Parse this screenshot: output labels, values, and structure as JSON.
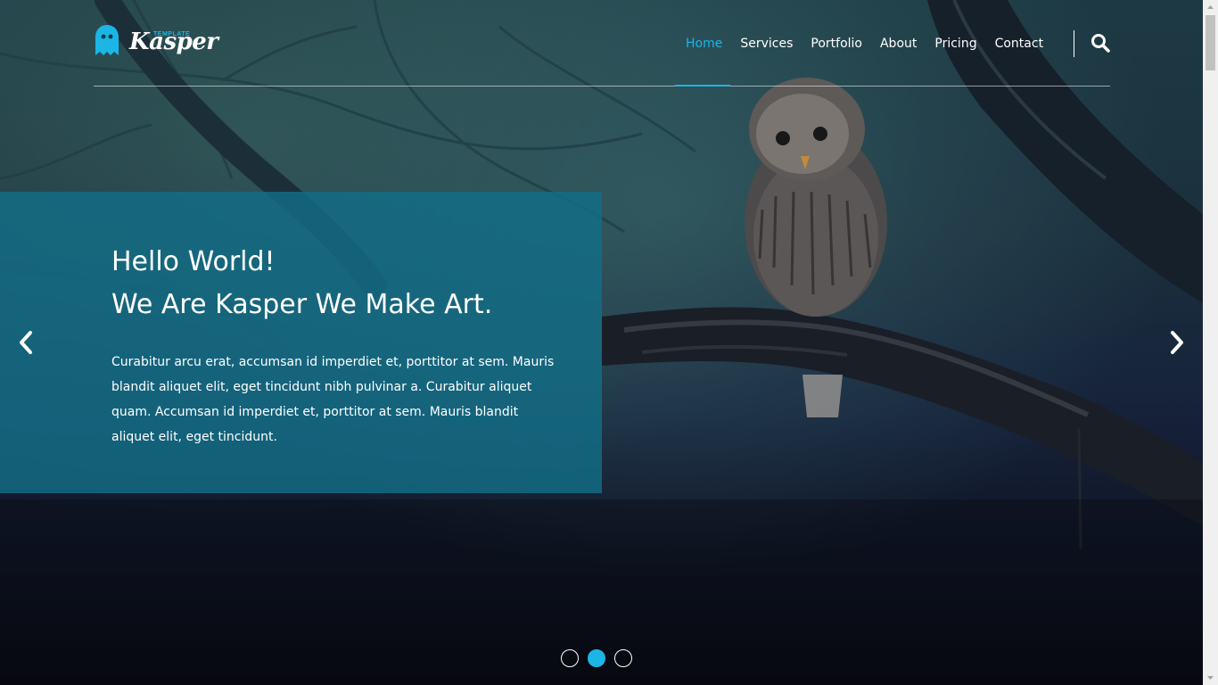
{
  "brand": {
    "name": "Kasper",
    "tag": "TEMPLATE",
    "accent": "#1bb6e5"
  },
  "nav": {
    "items": [
      {
        "label": "Home",
        "active": true
      },
      {
        "label": "Services",
        "active": false
      },
      {
        "label": "Portfolio",
        "active": false
      },
      {
        "label": "About",
        "active": false
      },
      {
        "label": "Pricing",
        "active": false
      },
      {
        "label": "Contact",
        "active": false
      }
    ],
    "search_icon": "search-icon"
  },
  "hero": {
    "headline_line1": "Hello World!",
    "headline_line2": "We Are Kasper We Make Art.",
    "body": "Curabitur arcu erat, accumsan id imperdiet et, porttitor at sem. Mauris blandit aliquet elit, eget tincidunt nibh pulvinar a. Curabitur aliquet quam. Accumsan id imperdiet et, porttitor at sem. Mauris blandit aliquet elit, eget tincidunt.",
    "box_color": "#126e87"
  },
  "carousel": {
    "prev_icon": "chevron-left-icon",
    "next_icon": "chevron-right-icon",
    "slides": 3,
    "active_slide": 2
  }
}
